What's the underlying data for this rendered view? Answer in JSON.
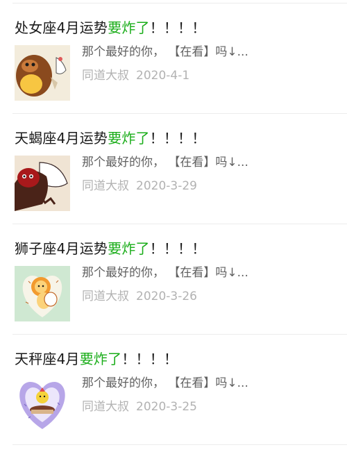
{
  "articles": [
    {
      "title_prefix": "处女座4月运势",
      "title_highlight": "要炸了",
      "title_suffix": "！！！！",
      "digest": "那个最好的你，  【在看】吗↓...",
      "author": "同道大叔",
      "date": "2020-4-1",
      "thumb_icon": "virgo-cartoon-thumbnail"
    },
    {
      "title_prefix": "天蝎座4月运势",
      "title_highlight": "要炸了",
      "title_suffix": "！！！！",
      "digest": "那个最好的你，  【在看】吗↓...",
      "author": "同道大叔",
      "date": "2020-3-29",
      "thumb_icon": "scorpio-cartoon-thumbnail"
    },
    {
      "title_prefix": "狮子座4月运势",
      "title_highlight": "要炸了",
      "title_suffix": "！！！！",
      "digest": "那个最好的你，  【在看】吗↓...",
      "author": "同道大叔",
      "date": "2020-3-26",
      "thumb_icon": "leo-cartoon-thumbnail"
    },
    {
      "title_prefix": "天秤座4月",
      "title_highlight": "要炸了",
      "title_suffix": "！！！！",
      "digest": "那个最好的你，  【在看】吗↓...",
      "author": "同道大叔",
      "date": "2020-3-25",
      "thumb_icon": "libra-cartoon-thumbnail"
    }
  ],
  "colors": {
    "highlight": "#1aad19",
    "digest": "#606060",
    "meta": "#b2b2b2",
    "divider": "#ececec"
  }
}
